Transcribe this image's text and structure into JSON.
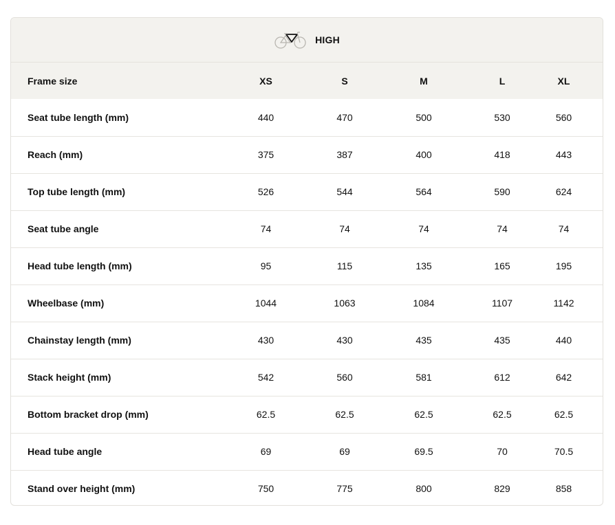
{
  "config": {
    "icon": "road-bike-icon",
    "label": "HIGH"
  },
  "table": {
    "header": [
      "Frame size",
      "XS",
      "S",
      "M",
      "L",
      "XL"
    ],
    "rows": [
      {
        "label": "Seat tube length (mm)",
        "values": [
          "440",
          "470",
          "500",
          "530",
          "560"
        ]
      },
      {
        "label": "Reach (mm)",
        "values": [
          "375",
          "387",
          "400",
          "418",
          "443"
        ]
      },
      {
        "label": "Top tube length (mm)",
        "values": [
          "526",
          "544",
          "564",
          "590",
          "624"
        ]
      },
      {
        "label": "Seat tube angle",
        "values": [
          "74",
          "74",
          "74",
          "74",
          "74"
        ]
      },
      {
        "label": "Head tube length (mm)",
        "values": [
          "95",
          "115",
          "135",
          "165",
          "195"
        ]
      },
      {
        "label": "Wheelbase (mm)",
        "values": [
          "1044",
          "1063",
          "1084",
          "1107",
          "1142"
        ]
      },
      {
        "label": "Chainstay length (mm)",
        "values": [
          "430",
          "430",
          "435",
          "435",
          "440"
        ]
      },
      {
        "label": "Stack height (mm)",
        "values": [
          "542",
          "560",
          "581",
          "612",
          "642"
        ]
      },
      {
        "label": "Bottom bracket drop (mm)",
        "values": [
          "62.5",
          "62.5",
          "62.5",
          "62.5",
          "62.5"
        ]
      },
      {
        "label": "Head tube angle",
        "values": [
          "69",
          "69",
          "69.5",
          "70",
          "70.5"
        ]
      },
      {
        "label": "Stand over height (mm)",
        "values": [
          "750",
          "775",
          "800",
          "829",
          "858"
        ]
      }
    ]
  }
}
